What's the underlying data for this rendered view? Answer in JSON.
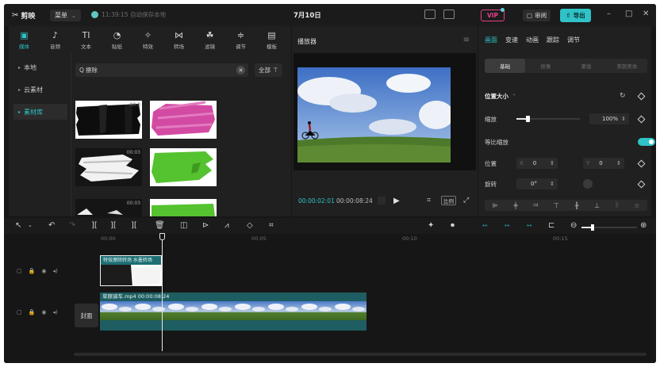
{
  "app": {
    "name": "剪映",
    "menu_label": "菜单",
    "save_status": "11:39:15 自动保存本地",
    "project_title": "7月10日"
  },
  "topbar": {
    "vip_label": "VIP",
    "review_label": "审阅",
    "export_label": "导出"
  },
  "media_tabs": [
    {
      "label": "媒体",
      "icon": "media-icon",
      "glyph": "▣",
      "active": true
    },
    {
      "label": "音频",
      "icon": "audio-icon",
      "glyph": "♪"
    },
    {
      "label": "文本",
      "icon": "text-icon",
      "glyph": "TI"
    },
    {
      "label": "贴纸",
      "icon": "sticker-icon",
      "glyph": "◔"
    },
    {
      "label": "特效",
      "icon": "effects-icon",
      "glyph": "✧"
    },
    {
      "label": "转场",
      "icon": "transition-icon",
      "glyph": "⋈"
    },
    {
      "label": "滤镜",
      "icon": "filter-icon",
      "glyph": "☘"
    },
    {
      "label": "调节",
      "icon": "adjust-icon",
      "glyph": "≑"
    },
    {
      "label": "模板",
      "icon": "template-icon",
      "glyph": "▤"
    }
  ],
  "sidebar": {
    "items": [
      {
        "label": "本地"
      },
      {
        "label": "云素材"
      },
      {
        "label": "素材库",
        "active": true
      }
    ]
  },
  "search": {
    "value": "擦除",
    "filter_label": "全部"
  },
  "thumbnails": [
    {
      "caption": "00:0"
    },
    {
      "caption": ""
    },
    {
      "caption": "00:03"
    },
    {
      "caption": ""
    },
    {
      "caption": "00:03"
    },
    {
      "caption": ""
    }
  ],
  "player": {
    "title": "播放器",
    "current_time": "00:00:02:01",
    "total_time": "00:00:08:24",
    "ratio_label": "比例"
  },
  "inspector": {
    "tabs": [
      {
        "label": "画面",
        "active": true
      },
      {
        "label": "变速"
      },
      {
        "label": "动画"
      },
      {
        "label": "跟踪"
      },
      {
        "label": "调节"
      }
    ],
    "subtabs": [
      {
        "label": "基础",
        "active": true
      },
      {
        "label": "抠像"
      },
      {
        "label": "蒙版"
      },
      {
        "label": "美颜美体"
      }
    ],
    "position_size_label": "位置大小",
    "scale_label": "缩放",
    "scale_value": "100%",
    "scale_fraction": 0.18,
    "uniform_scale_label": "等比缩放",
    "uniform_scale_on": true,
    "position_label": "位置",
    "x_label": "X",
    "x_value": "0",
    "y_label": "Y",
    "y_value": "0",
    "rotate_label": "旋转",
    "rotate_value": "0°"
  },
  "timeline": {
    "ruler": [
      "00:00",
      "00:05",
      "00:10",
      "00:15"
    ],
    "effect_clip_label": "特效擦除转场 水墨转场",
    "video_clip_label": "草原骑车.mp4  00:00:08:24",
    "cover_label": "封面"
  },
  "colors": {
    "accent": "#2fc2c6",
    "panel": "#202020",
    "vip": "#e2408a"
  }
}
